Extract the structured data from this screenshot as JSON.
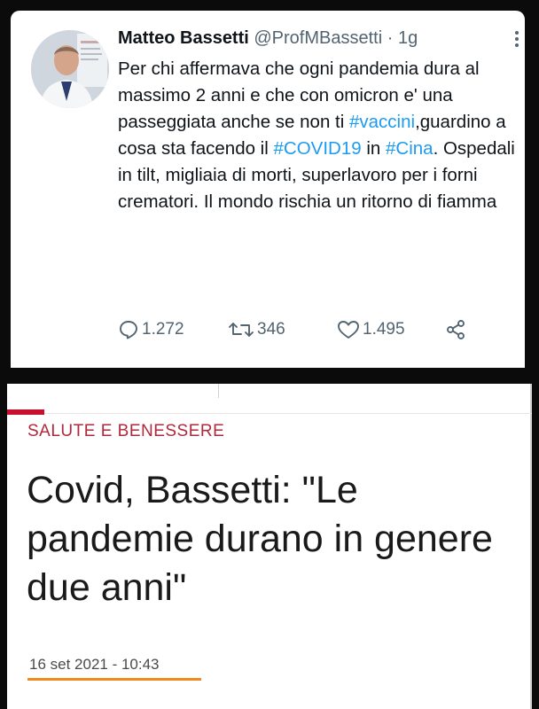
{
  "tweet": {
    "display_name": "Matteo Bassetti",
    "handle": "@ProfMBassetti",
    "separator": " · ",
    "age": "1g",
    "more_icon": "more-vertical-icon",
    "text_parts": [
      "Per chi affermava che ogni pandemia dura al massimo 2 anni e che con omicron e' una passeggiata anche se non ti ",
      "#vaccini",
      ",guardino a cosa sta facendo il ",
      "#COVID19",
      " in ",
      "#Cina",
      ". Ospedali in tilt, migliaia di morti, superlavoro per i forni crematori. Il mondo rischia un ritorno di fiamma"
    ],
    "actions": {
      "replies": "1.272",
      "retweets": "346",
      "likes": "1.495",
      "share_icon": "share-icon"
    },
    "colors": {
      "link": "#1d9bf0",
      "text": "#0f1419",
      "muted": "#536471"
    }
  },
  "article": {
    "section": "SALUTE E BENESSERE",
    "headline": "Covid, Bassetti: \"Le pandemie durano in genere due anni\"",
    "date": "16 set 2021 - 10:43",
    "colors": {
      "accent": "#c8102e",
      "section": "#b1283c",
      "underline": "#f08a1c"
    }
  }
}
